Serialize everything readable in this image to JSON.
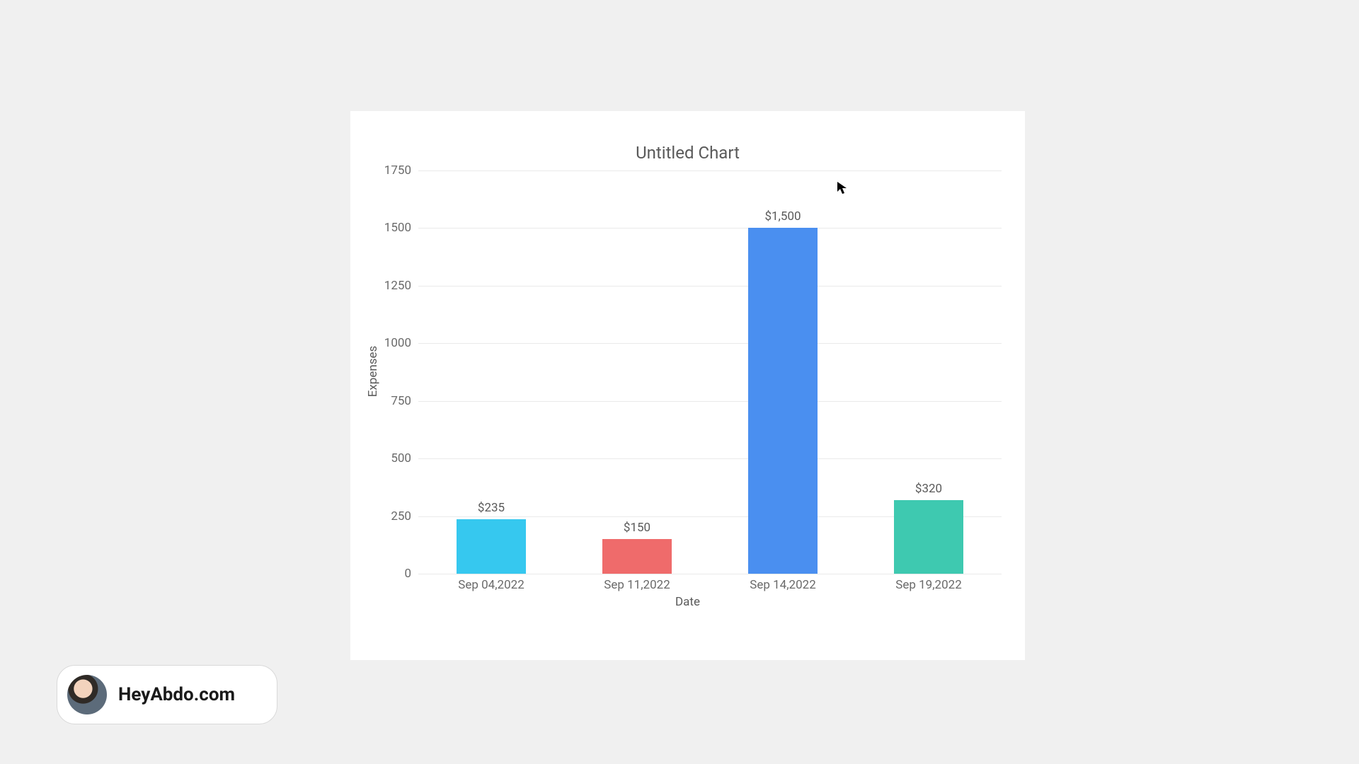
{
  "chart_data": {
    "type": "bar",
    "title": "Untitled Chart",
    "xlabel": "Date",
    "ylabel": "Expenses",
    "categories": [
      "Sep 04,2022",
      "Sep 11,2022",
      "Sep 14,2022",
      "Sep 19,2022"
    ],
    "values": [
      235,
      150,
      1500,
      320
    ],
    "value_labels": [
      "$235",
      "$150",
      "$1,500",
      "$320"
    ],
    "colors": [
      "#36c8ef",
      "#ef6b6b",
      "#4a8ff0",
      "#3ec9b0"
    ],
    "ylim": [
      0,
      1750
    ],
    "y_ticks": [
      0,
      250,
      500,
      750,
      1000,
      1250,
      1500,
      1750
    ]
  },
  "branding": {
    "label": "HeyAbdo.com"
  }
}
